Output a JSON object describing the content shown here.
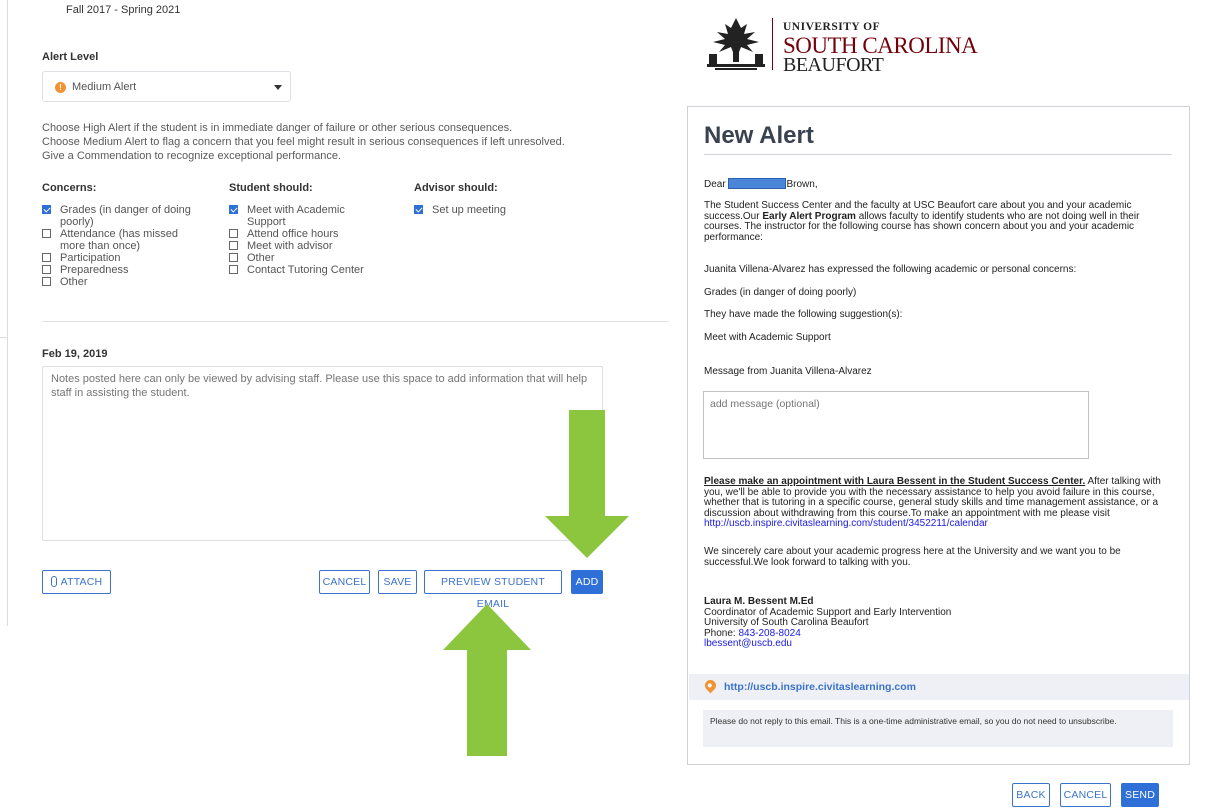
{
  "term": "Fall 2017 - Spring 2021",
  "alert_level": {
    "label": "Alert Level",
    "selected": "Medium Alert"
  },
  "help_lines": [
    "Choose High Alert if the student is in immediate danger of failure or other serious consequences.",
    "Choose Medium Alert to flag a concern that you feel might result in serious consequences if left unresolved.",
    "Give a Commendation to recognize exceptional performance."
  ],
  "concerns": {
    "heading": "Concerns:",
    "items": [
      {
        "label": "Grades (in danger of doing poorly)",
        "checked": true
      },
      {
        "label": "Attendance (has missed more than once)",
        "checked": false
      },
      {
        "label": "Participation",
        "checked": false
      },
      {
        "label": "Preparedness",
        "checked": false
      },
      {
        "label": "Other",
        "checked": false
      }
    ]
  },
  "student_should": {
    "heading": "Student should:",
    "items": [
      {
        "label": "Meet with Academic Support",
        "checked": true
      },
      {
        "label": "Attend office hours",
        "checked": false
      },
      {
        "label": "Meet with advisor",
        "checked": false
      },
      {
        "label": "Other",
        "checked": false
      },
      {
        "label": "Contact Tutoring Center",
        "checked": false
      }
    ]
  },
  "advisor_should": {
    "heading": "Advisor should:",
    "items": [
      {
        "label": "Set up meeting",
        "checked": true
      }
    ]
  },
  "note": {
    "date": "Feb 19, 2019",
    "placeholder": "Notes posted here can only be viewed by advising staff. Please use this space to add information that will help staff in assisting the student."
  },
  "buttons": {
    "attach": "ATTACH",
    "cancel": "CANCEL",
    "save": "SAVE",
    "preview": "PREVIEW STUDENT EMAIL",
    "add": "ADD"
  },
  "logo": {
    "line1": "UNIVERSITY OF",
    "line2": "SOUTH CAROLINA",
    "line3": "BEAUFORT"
  },
  "email": {
    "title": "New Alert",
    "dear": "Dear",
    "last_name": "Brown,",
    "intro_1": "The Student Success Center and the faculty at USC Beaufort care about you and your academic success.Our ",
    "intro_bold": "Early Alert Program",
    "intro_2": " allows faculty to identify students who are not doing well in their courses. The instructor for the following course has shown concern about you and your academic performance:",
    "concern_line": "Juanita Villena-Alvarez has expressed the following academic or personal concerns:",
    "concern_value": "Grades (in danger of doing poorly)",
    "suggestion_line": "They have made the following suggestion(s):",
    "suggestion_value": "Meet with Academic Support",
    "message_from": "Message from Juanita Villena-Alvarez",
    "message_placeholder": "add message (optional)",
    "appt_link": "Please make an appointment with Laura Bessent in the Student Success Center.",
    "appt_text": " After talking with you, we'll be able to provide you with the necessary assistance to help you avoid failure in this course, whether that is tutoring in a specific course, general study skills and time management assistance, or a discussion about withdrawing from this course.To make an appointment with me please visit ",
    "calendar_url": "http://uscb.inspire.civitaslearning.com/student/3452211/calendar",
    "closing": "We sincerely care about your academic progress here at the University and we want you to be successful.We look forward to talking with you.",
    "sig_name": "Laura M. Bessent M.Ed",
    "sig_title": "Coordinator of Academic Support and Early Intervention",
    "sig_org": "University of South Carolina Beaufort",
    "sig_phone_label": "Phone: ",
    "sig_phone": "843-208-8024",
    "sig_email": "lbessent@uscb.edu",
    "site_url": "http://uscb.inspire.civitaslearning.com",
    "notice": "Please do not reply to this email. This is a one-time administrative email, so you do not need to unsubscribe."
  },
  "email_buttons": {
    "back": "BACK",
    "cancel": "CANCEL",
    "send": "SEND"
  },
  "colors": {
    "primary": "#2f6fd8",
    "alert_orange": "#f19233",
    "arrow_green": "#8cc63f",
    "usc_garnet": "#73000a"
  }
}
